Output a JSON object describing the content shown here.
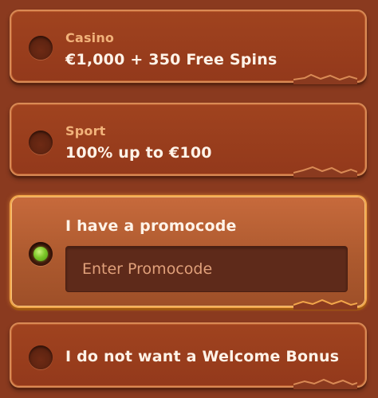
{
  "options": [
    {
      "category": "Casino",
      "offer": "€1,000 + 350 Free Spins",
      "selected": false
    },
    {
      "category": "Sport",
      "offer": "100% up to €100",
      "selected": false
    },
    {
      "offer": "I have a promocode",
      "selected": true,
      "input_placeholder": "Enter Promocode",
      "input_value": ""
    },
    {
      "offer": "I do not want a Welcome Bonus",
      "selected": false
    }
  ],
  "colors": {
    "background": "#8a3a1f",
    "card": "#9a3f1d",
    "card_selected": "#bb6535",
    "border": "#d98a55",
    "border_selected": "#f2a64a",
    "category_text": "#f1b27a",
    "main_text": "#fff3e8",
    "radio_active": "#7ec92a"
  },
  "icons": {
    "radio_unselected": "radio-empty-icon",
    "radio_selected": "radio-green-dot-icon"
  }
}
